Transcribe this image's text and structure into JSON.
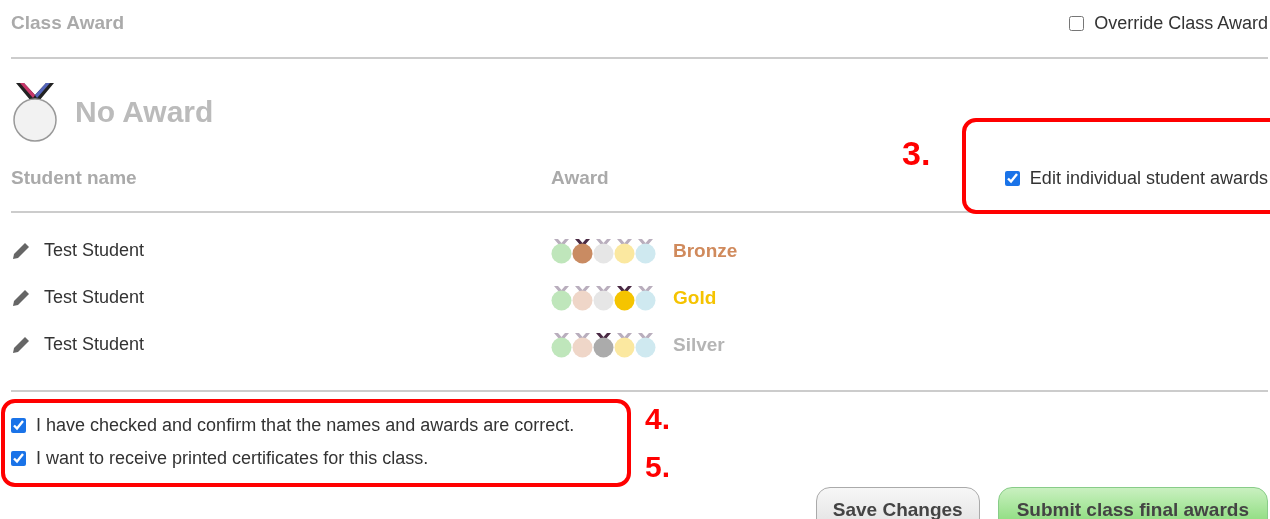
{
  "header": {
    "title": "Class Award",
    "override": {
      "label": "Override Class Award",
      "checked": false
    }
  },
  "class_award": {
    "label": "No Award"
  },
  "table": {
    "columns": [
      "Student name",
      "Award"
    ],
    "edit_toggle": {
      "label": "Edit individual student awards",
      "checked": true
    },
    "rows": [
      {
        "name": "Test Student",
        "award": "Bronze",
        "color": "#d08a5c",
        "medals": [
          {
            "color": "#bfe6bb",
            "selected": false
          },
          {
            "color": "#c98b62",
            "selected": true
          },
          {
            "color": "#e6e6e6",
            "selected": false
          },
          {
            "color": "#fbe8a0",
            "selected": false
          },
          {
            "color": "#cfe9f0",
            "selected": false
          }
        ]
      },
      {
        "name": "Test Student",
        "award": "Gold",
        "color": "#f5c300",
        "medals": [
          {
            "color": "#bfe6bb",
            "selected": false
          },
          {
            "color": "#efd6c8",
            "selected": false
          },
          {
            "color": "#e6e6e6",
            "selected": false
          },
          {
            "color": "#f5c400",
            "selected": true
          },
          {
            "color": "#cfe9f0",
            "selected": false
          }
        ]
      },
      {
        "name": "Test Student",
        "award": "Silver",
        "color": "#b5b5b5",
        "medals": [
          {
            "color": "#bfe6bb",
            "selected": false
          },
          {
            "color": "#efd6c8",
            "selected": false
          },
          {
            "color": "#ababab",
            "selected": true
          },
          {
            "color": "#fbe8a0",
            "selected": false
          },
          {
            "color": "#cfe9f0",
            "selected": false
          }
        ]
      }
    ]
  },
  "confirmations": [
    {
      "label": "I have checked and confirm that the names and awards are correct.",
      "checked": true
    },
    {
      "label": "I want to receive printed certificates for this class.",
      "checked": true
    }
  ],
  "buttons": [
    {
      "label": "Save Changes",
      "kind": "secondary"
    },
    {
      "label": "Submit class final awards",
      "kind": "primary"
    }
  ],
  "annotations": [
    "3.",
    "4.",
    "5."
  ]
}
